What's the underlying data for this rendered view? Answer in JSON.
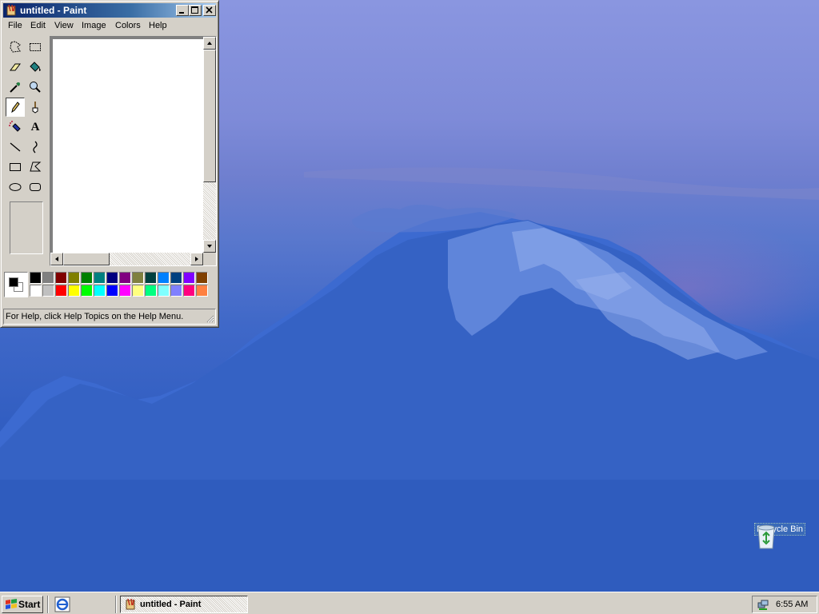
{
  "window": {
    "title": "untitled - Paint",
    "controls": {
      "minimize": "_",
      "maximize": "□",
      "close": "✕"
    }
  },
  "menu": [
    "File",
    "Edit",
    "View",
    "Image",
    "Colors",
    "Help"
  ],
  "tools": [
    "free-form-select",
    "select",
    "eraser",
    "fill-with-color",
    "pick-color",
    "magnifier",
    "pencil",
    "brush",
    "airbrush",
    "text",
    "line",
    "curve",
    "rectangle",
    "polygon",
    "ellipse",
    "rounded-rectangle"
  ],
  "text_tool_glyph": "A",
  "active_tool": "pencil",
  "palette": {
    "foreground": "#000000",
    "background": "#ffffff",
    "row1": [
      "#000000",
      "#808080",
      "#800000",
      "#808000",
      "#008000",
      "#008080",
      "#000080",
      "#800080",
      "#808040",
      "#004040",
      "#0080ff",
      "#004080",
      "#8000ff",
      "#804000"
    ],
    "row2": [
      "#ffffff",
      "#c0c0c0",
      "#ff0000",
      "#ffff00",
      "#00ff00",
      "#00ffff",
      "#0000ff",
      "#ff00ff",
      "#ffff80",
      "#00ff80",
      "#80ffff",
      "#8080ff",
      "#ff0080",
      "#ff8040"
    ]
  },
  "status": "For Help, click Help Topics on the Help Menu.",
  "desktop": {
    "icons": [
      {
        "label": "Recycle Bin",
        "icon": "recycle-bin-icon"
      }
    ]
  },
  "taskbar": {
    "start_label": "Start",
    "quicklaunch": [
      "internet-explorer-icon"
    ],
    "tasks": [
      {
        "label": "untitled - Paint",
        "icon": "paint-icon",
        "active": true
      }
    ],
    "clock": "6:55 AM"
  }
}
